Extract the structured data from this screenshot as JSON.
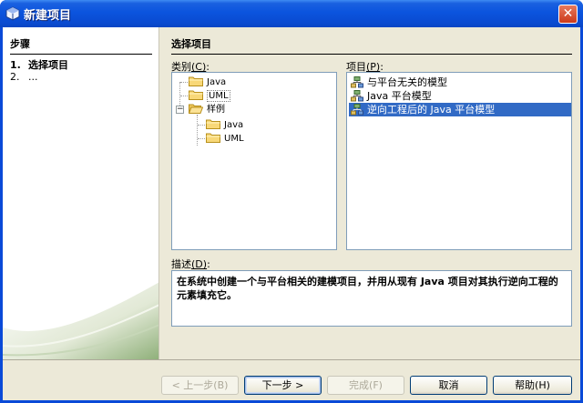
{
  "window": {
    "title": "新建项目",
    "close_glyph": "✕"
  },
  "steps": {
    "header": "步骤",
    "items": [
      {
        "num": "1.",
        "label": "选择项目"
      },
      {
        "num": "2.",
        "label": "..."
      }
    ]
  },
  "content": {
    "title": "选择项目",
    "categories_label": "类别",
    "categories_mnemonic": "(C)",
    "categories_suffix": ":",
    "projects_label": "项目",
    "projects_mnemonic": "(P)",
    "projects_suffix": ":",
    "categories": [
      {
        "label": "Java"
      },
      {
        "label": "UML"
      },
      {
        "label": "样例",
        "toggle": "−"
      },
      {
        "label": "Java"
      },
      {
        "label": "UML"
      }
    ],
    "projects": [
      {
        "label": "与平台无关的模型"
      },
      {
        "label": "Java 平台模型"
      },
      {
        "label": "逆向工程后的 Java 平台模型",
        "selected": true
      }
    ],
    "description_label": "描述",
    "description_mnemonic": "(D)",
    "description_suffix": ":",
    "description": "在系统中创建一个与平台相关的建模项目，并用从现有 Java 项目对其执行逆向工程的元素填充它。"
  },
  "buttons": {
    "back": "< 上一步(B)",
    "next": "下一步 >",
    "finish": "完成(F)",
    "cancel": "取消",
    "help": "帮助(H)"
  },
  "colors": {
    "title_bar": "#0b54de",
    "selection": "#316ac5",
    "dialog_bg": "#ece9d8"
  },
  "icons": [
    "app-icon",
    "close-icon",
    "folder-icon",
    "project-icon"
  ]
}
